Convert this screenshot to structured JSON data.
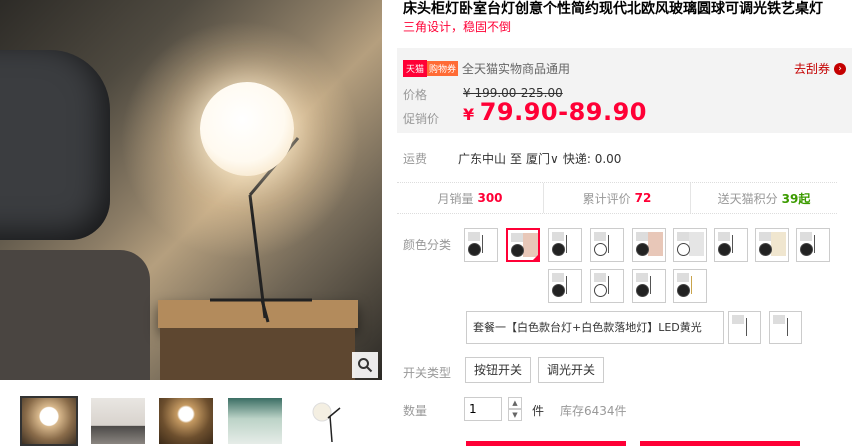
{
  "product": {
    "title": "床头柜灯卧室台灯创意个性简约现代北欧风玻璃圆球可调光铁艺桌灯",
    "subtitle": "三角设计，稳固不倒"
  },
  "coupon": {
    "badge_tmall": "天猫",
    "badge_coupon": "购物券",
    "text": "全天猫实物商品通用",
    "get_label": "去刮券",
    "get_icon": "arrow-right-circle"
  },
  "price": {
    "label": "价格",
    "original": "¥ 199.00-225.00",
    "promo_label": "促销价",
    "promo_symbol": "¥",
    "promo_value": "79.90-89.90",
    "accent_color": "#ff0036"
  },
  "shipping": {
    "label": "运费",
    "from": "广东中山",
    "to_word": "至",
    "to_city": "厦门",
    "express": "快递: 0.00"
  },
  "stats": {
    "monthly_label": "月销量",
    "monthly_value": "300",
    "reviews_label": "累计评价",
    "reviews_value": "72",
    "points_label": "送天猫积分",
    "points_value": "39起"
  },
  "options": {
    "color_label": "颜色分类",
    "combo_text": "套餐一【白色款台灯+白色款落地灯】LED黄光",
    "switch_label": "开关类型",
    "switch_options": [
      "按钮开关",
      "调光开关"
    ]
  },
  "quantity": {
    "label": "数量",
    "value": "1",
    "unit": "件",
    "stock": "库存6434件"
  }
}
